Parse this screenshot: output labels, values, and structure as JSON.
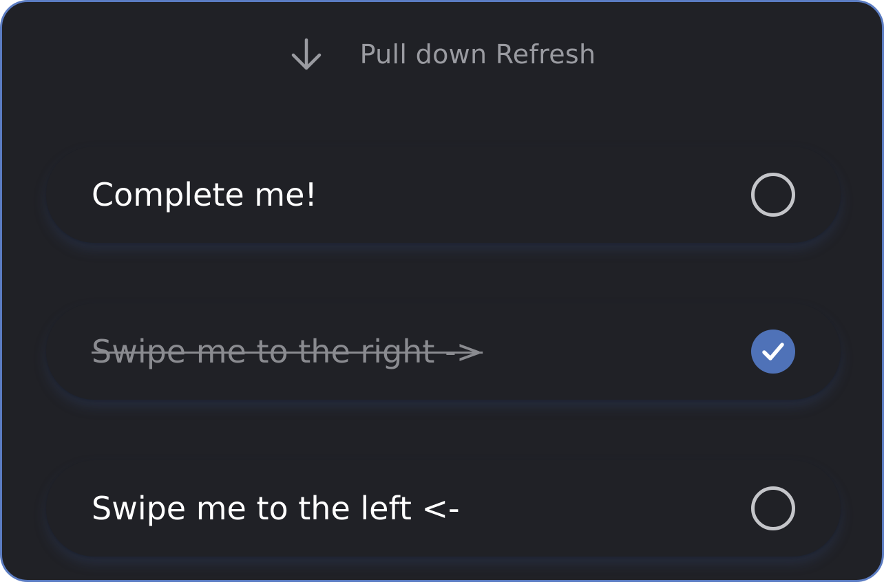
{
  "header": {
    "refresh_icon": "arrow-down-icon",
    "refresh_label": "Pull down Refresh"
  },
  "todos": [
    {
      "label": "Complete me!",
      "completed": false
    },
    {
      "label": "Swipe me to the right ->",
      "completed": true
    },
    {
      "label": "Swipe me to the left <-",
      "completed": false
    }
  ],
  "colors": {
    "background": "#202126",
    "border": "#5b7cc2",
    "accent": "#4f72b8",
    "text": "#ffffff",
    "muted_text": "#9a9ba1",
    "unchecked_ring": "#c4c5c9"
  },
  "icons": {
    "unchecked": "circle-outline-icon",
    "checked": "checkmark-circle-icon"
  }
}
